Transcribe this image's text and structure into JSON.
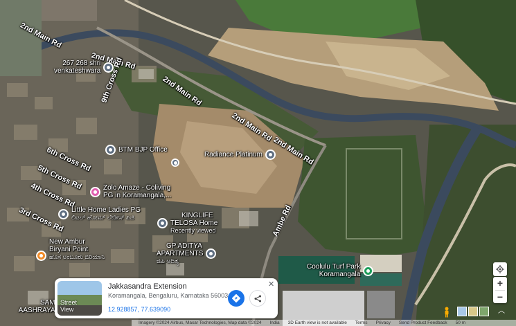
{
  "roads": {
    "r1": "2nd Main Rd",
    "r2": "2nd Main Rd",
    "r3": "2nd Main Rd",
    "r4": "2nd Main Rd",
    "r5": "2nd Main Rd",
    "cross9": "9th Cross Rd",
    "cross6": "6th Cross Rd",
    "cross5": "5th Cross Rd",
    "cross4": "4th Cross Rd",
    "cross3": "3rd Cross Rd",
    "ambe": "Ambe Rd"
  },
  "pois": {
    "shri": {
      "line1": "267 268 shri",
      "line2": "venkateshwara"
    },
    "btm": {
      "name": "BTM BJP Office"
    },
    "radiance": {
      "name": "Radiance Platinum"
    },
    "zolo": {
      "line1": "Zolo Amaze - Coliving",
      "line2": "PG in Koramangala,..."
    },
    "little": {
      "name": "Little Home Ladies PG",
      "kannada": "ಲಿಟಲ್ ಹೋಮ್ ಲೇಡೀಸ್ ಪಿಜಿ"
    },
    "kinglife": {
      "line1": "KINGLIFE",
      "line2": "TELOSA Home",
      "sub": "Recently viewed"
    },
    "ambur": {
      "line1": "New Ambur",
      "line2": "Biryani Point",
      "kannada": "ಹೊಸ ಅಂಬೂರು ಬಿರಿಯಾನಿ"
    },
    "gp": {
      "line1": "GP ADITYA",
      "line2": "APARTMENTS",
      "kannada": "ಜಿಪಿ ಆದಿತ್ಯ"
    },
    "coolulu": {
      "line1": "Coolulu Turf Park",
      "line2": "Koramangala"
    },
    "sam": {
      "line1": "SAM",
      "line2": "AASHRAYA"
    }
  },
  "card": {
    "title": "Jakkasandra Extension",
    "address": "Koramangala, Bengaluru, Karnataka 560034",
    "coords": "12.928857, 77.639090",
    "thumb_label_1": "Street",
    "thumb_label_2": "View",
    "close": "✕"
  },
  "bottombar": {
    "imagery": "Imagery ©2024 Airbus, Maxar Technologies, Map data ©2024",
    "india": "India",
    "view": "3D Earth view is not available",
    "terms": "Terms",
    "privacy": "Privacy",
    "feedback": "Send Product Feedback",
    "scale": "50 m"
  },
  "icons": {
    "locate": "my-location-icon",
    "zoom_in": "plus-icon",
    "zoom_out": "minus-icon",
    "directions": "directions-icon",
    "share": "share-icon",
    "pegman": "pegman-icon",
    "expand": "chevron-up-icon"
  },
  "colors": {
    "accent": "#1a73e8",
    "canal": "#3b4a5e",
    "vegetation": "#3f5a2c",
    "dirt": "#b49a72"
  }
}
